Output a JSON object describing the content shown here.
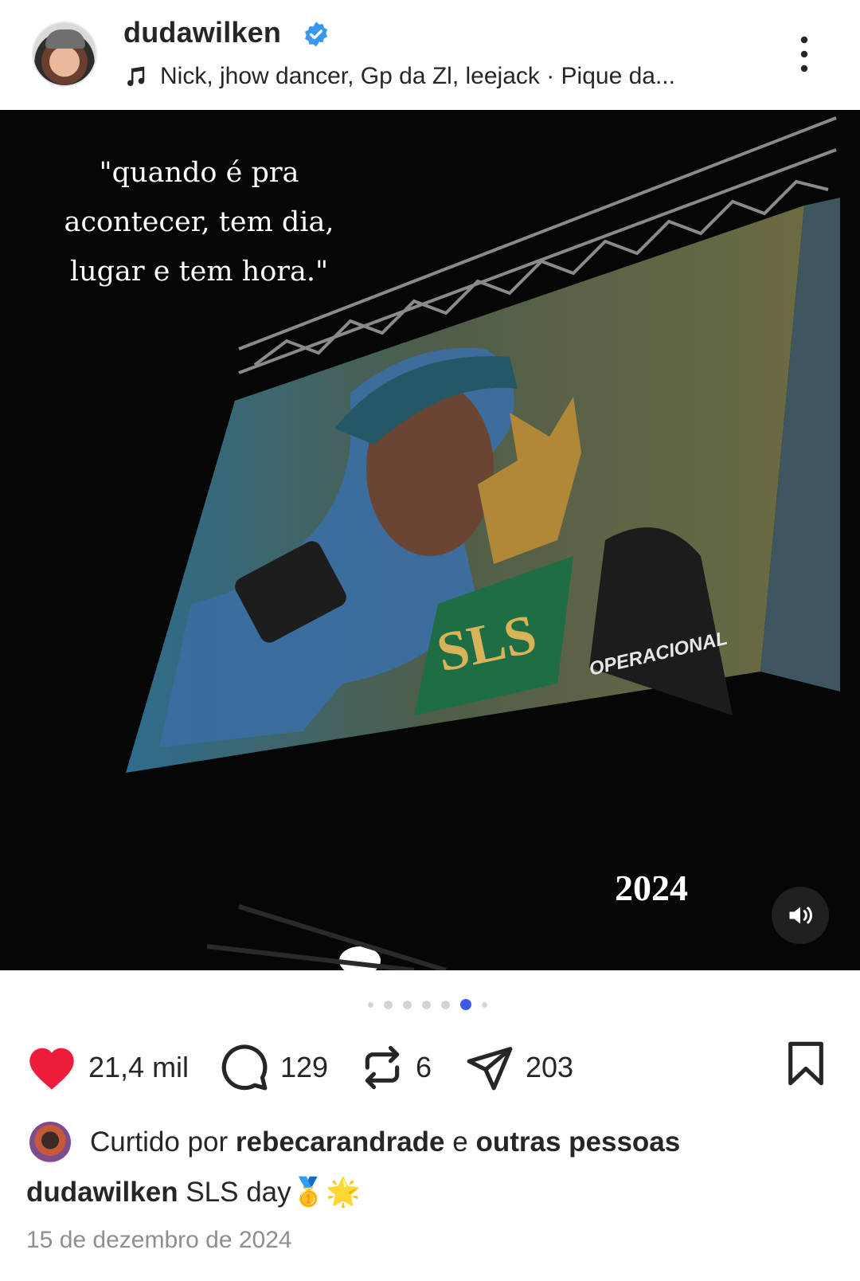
{
  "header": {
    "username": "dudawilken",
    "music": "Nick, jhow dancer, Gp da Zl, leejack · Pique da..."
  },
  "media": {
    "quote_lines": [
      "\"quando é pra",
      "acontecer, tem dia,",
      "lugar e tem hora.\""
    ],
    "year": "2024",
    "carousel": {
      "count": 7,
      "active_index": 5
    }
  },
  "actions": {
    "likes": "21,4 mil",
    "comments": "129",
    "reposts": "6",
    "shares": "203"
  },
  "liked_by": {
    "prefix": "Curtido por",
    "user": "rebecarandrade",
    "joiner": "e",
    "others": "outras pessoas"
  },
  "caption": {
    "username": "dudawilken",
    "text": "SLS day🥇🌟"
  },
  "date": "15 de dezembro de 2024",
  "colors": {
    "like": "#ed1c3a",
    "verified": "#3897f0",
    "active_dot": "#3a5bea"
  }
}
